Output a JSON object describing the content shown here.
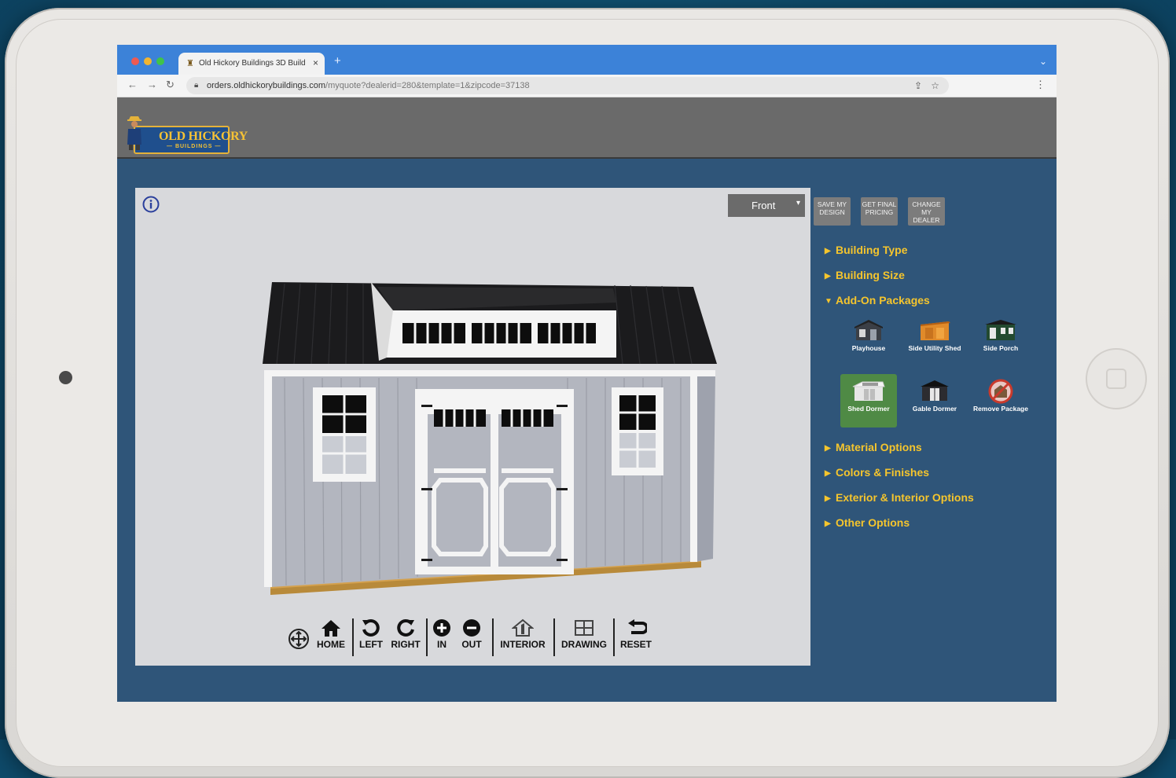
{
  "browser": {
    "tab_title": "Old Hickory Buildings 3D Build",
    "tab_close": "×",
    "new_tab": "+",
    "url_domain": "orders.oldhickorybuildings.com",
    "url_path": "/myquote?dealerid=280&template=1&zipcode=37138"
  },
  "header": {
    "logo_title": "OLD HICKORY",
    "logo_sub": "— BUILDINGS —"
  },
  "viewer": {
    "view_select": "Front",
    "toolbar": {
      "home": "HOME",
      "left": "LEFT",
      "right": "RIGHT",
      "in": "IN",
      "out": "OUT",
      "interior": "INTERIOR",
      "drawing": "DRAWING",
      "reset": "RESET"
    }
  },
  "sidebar": {
    "actions": {
      "save": "SAVE MY DESIGN",
      "pricing": "GET FINAL PRICING",
      "dealer": "CHANGE MY DEALER"
    },
    "sections": {
      "building_type": "Building Type",
      "building_size": "Building Size",
      "addon_packages": "Add-On Packages",
      "material_options": "Material Options",
      "colors_finishes": "Colors & Finishes",
      "exterior_interior": "Exterior & Interior Options",
      "other_options": "Other Options"
    },
    "packages": {
      "playhouse": "Playhouse",
      "side_utility": "Side Utility Shed",
      "side_porch": "Side Porch",
      "shed_dormer": "Shed Dormer",
      "gable_dormer": "Gable Dormer",
      "remove_package": "Remove Package"
    },
    "selected_package": "Shed Dormer"
  },
  "colors": {
    "accent_gold": "#f5c52d",
    "panel_blue": "#2f5579",
    "selected_green": "#4f8a45",
    "browser_blue": "#3c82d8"
  }
}
